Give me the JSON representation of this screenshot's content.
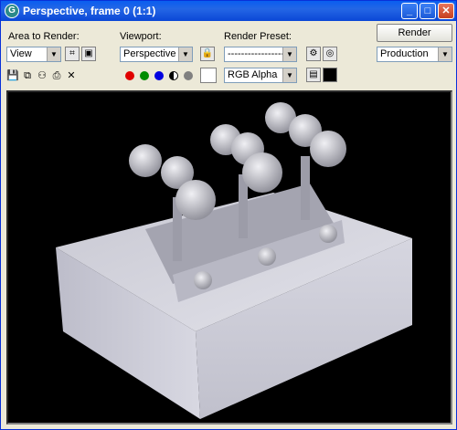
{
  "window": {
    "title": "Perspective, frame 0 (1:1)"
  },
  "controls": {
    "area_label": "Area to Render:",
    "area_value": "View",
    "viewport_label": "Viewport:",
    "viewport_value": "Perspective",
    "preset_label": "Render Preset:",
    "preset_value": "--------------------------",
    "render_button": "Render",
    "production_value": "Production",
    "channel_value": "RGB Alpha"
  },
  "colors": {
    "titlebar": "#0a5ef0",
    "red": "#e00000",
    "green": "#008c00",
    "blue": "#0000e0"
  }
}
